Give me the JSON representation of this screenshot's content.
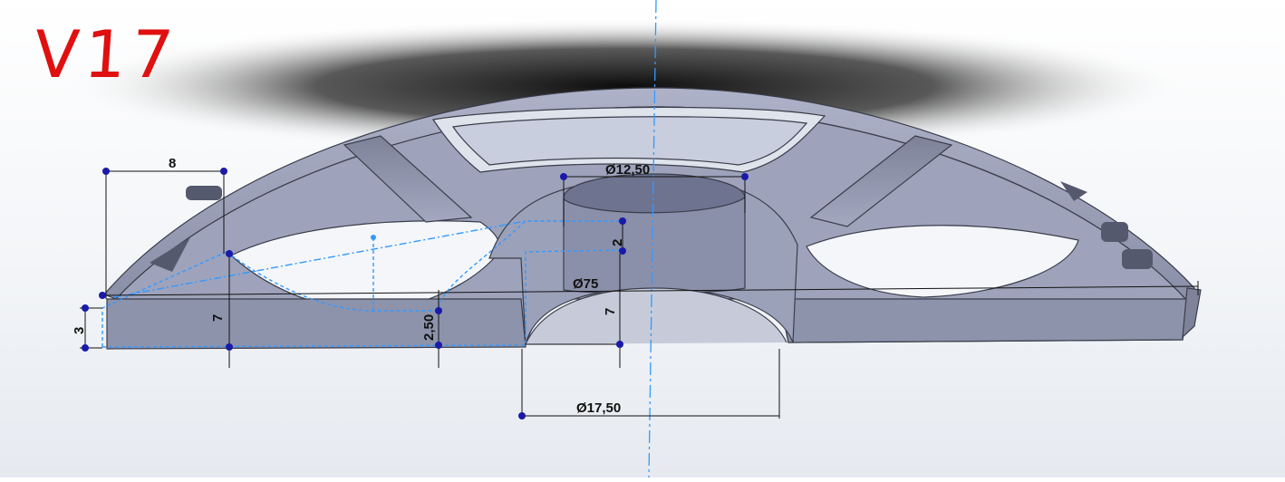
{
  "annotation": {
    "version_label": "V17",
    "color": "#e01010"
  },
  "model": {
    "body_color": "#9a9fb8",
    "edge_color": "#3a3d4a",
    "sketch_color": "#3399ff",
    "point_color": "#1a1aa8"
  },
  "dimensions": {
    "width_top": "8",
    "diameter_hub_top": "Ø12,50",
    "hub_step": "2",
    "diameter_overall": "Ø75",
    "edge_height": "3",
    "height_left": "7",
    "pocket_depth": "2,50",
    "height_right": "7",
    "diameter_bottom": "Ø17,50"
  }
}
